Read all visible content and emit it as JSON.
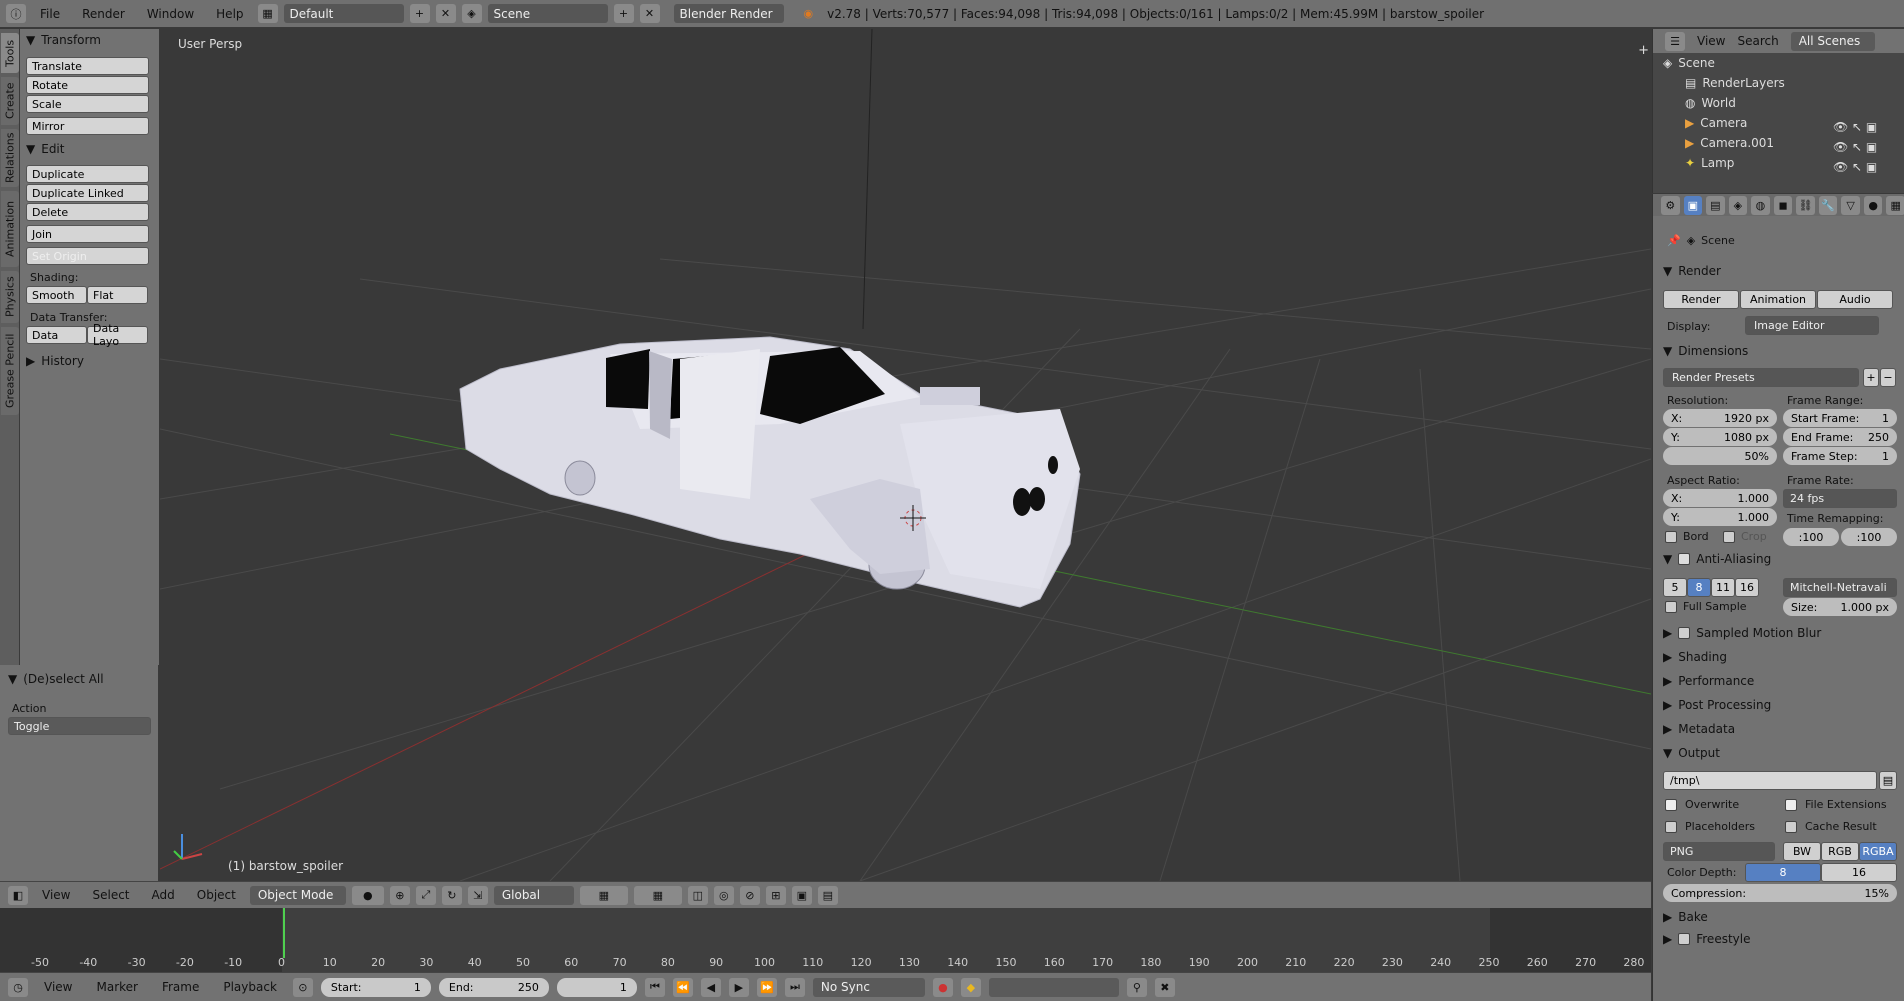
{
  "topbar": {
    "menus": [
      "File",
      "Render",
      "Window",
      "Help"
    ],
    "layout": "Default",
    "scene": "Scene",
    "engine": "Blender Render",
    "stats": "v2.78 | Verts:70,577 | Faces:94,098 | Tris:94,098 | Objects:0/161 | Lamps:0/2 | Mem:45.99M | barstow_spoiler"
  },
  "tabs": [
    "Tools",
    "Create",
    "Relations",
    "Animation",
    "Physics",
    "Grease Pencil"
  ],
  "toolshelf": {
    "transform_title": "Transform",
    "translate": "Translate",
    "rotate": "Rotate",
    "scale": "Scale",
    "mirror": "Mirror",
    "edit_title": "Edit",
    "duplicate": "Duplicate",
    "duplicate_linked": "Duplicate Linked",
    "delete": "Delete",
    "join": "Join",
    "set_origin": "Set Origin",
    "shading_label": "Shading:",
    "smooth": "Smooth",
    "flat": "Flat",
    "data_transfer_label": "Data Transfer:",
    "data": "Data",
    "data_layout": "Data Layo",
    "history_title": "History"
  },
  "operator": {
    "title": "(De)select All",
    "action_label": "Action",
    "action_value": "Toggle"
  },
  "viewport": {
    "perspective": "User Persp",
    "object_label": "(1) barstow_spoiler"
  },
  "header3d": {
    "menus": [
      "View",
      "Select",
      "Add",
      "Object"
    ],
    "mode": "Object Mode",
    "orientation": "Global"
  },
  "timeline": {
    "ticks": [
      "-50",
      "-40",
      "-30",
      "-20",
      "-10",
      "0",
      "10",
      "20",
      "30",
      "40",
      "50",
      "60",
      "70",
      "80",
      "90",
      "100",
      "110",
      "120",
      "130",
      "140",
      "150",
      "160",
      "170",
      "180",
      "190",
      "200",
      "210",
      "220",
      "230",
      "240",
      "250",
      "260",
      "270",
      "280"
    ],
    "menus": [
      "View",
      "Marker",
      "Frame",
      "Playback"
    ],
    "start_label": "Start:",
    "start": "1",
    "end_label": "End:",
    "end": "250",
    "current": "1",
    "sync": "No Sync"
  },
  "outliner": {
    "menus": [
      "View",
      "Search"
    ],
    "scenes": "All Scenes",
    "items": [
      "Scene",
      "RenderLayers",
      "World",
      "Camera",
      "Camera.001",
      "Lamp"
    ]
  },
  "properties": {
    "context": "Scene",
    "render_title": "Render",
    "render_btn": "Render",
    "animation_btn": "Animation",
    "audio_btn": "Audio",
    "display_label": "Display:",
    "display_value": "Image Editor",
    "dimensions_title": "Dimensions",
    "presets": "Render Presets",
    "resolution_label": "Resolution:",
    "res_x_label": "X:",
    "res_x": "1920 px",
    "res_y_label": "Y:",
    "res_y": "1080 px",
    "res_pct": "50%",
    "frame_range_label": "Frame Range:",
    "start_frame_label": "Start Frame:",
    "start_frame": "1",
    "end_frame_label": "End Frame:",
    "end_frame": "250",
    "frame_step_label": "Frame Step:",
    "frame_step": "1",
    "aspect_label": "Aspect Ratio:",
    "aspect_x_label": "X:",
    "aspect_x": "1.000",
    "aspect_y_label": "Y:",
    "aspect_y": "1.000",
    "frame_rate_label": "Frame Rate:",
    "frame_rate": "24 fps",
    "time_remap_label": "Time Remapping:",
    "remap_old": ":100",
    "remap_new": ":100",
    "bord": "Bord",
    "crop": "Crop",
    "aa_title": "Anti-Aliasing",
    "aa_samples": [
      "5",
      "8",
      "11",
      "16"
    ],
    "aa_filter": "Mitchell-Netravali",
    "full_sample": "Full Sample",
    "size_label": "Size:",
    "size": "1.000 px",
    "sampled_motion_blur": "Sampled Motion Blur",
    "shading_title": "Shading",
    "performance_title": "Performance",
    "post_processing_title": "Post Processing",
    "metadata_title": "Metadata",
    "output_title": "Output",
    "output_path": "/tmp\\",
    "overwrite": "Overwrite",
    "file_extensions": "File Extensions",
    "placeholders": "Placeholders",
    "cache_result": "Cache Result",
    "format": "PNG",
    "bw": "BW",
    "rgb": "RGB",
    "rgba": "RGBA",
    "color_depth_label": "Color Depth:",
    "depth_8": "8",
    "depth_16": "16",
    "compression_label": "Compression:",
    "compression": "15%",
    "bake_title": "Bake",
    "freestyle_title": "Freestyle"
  }
}
